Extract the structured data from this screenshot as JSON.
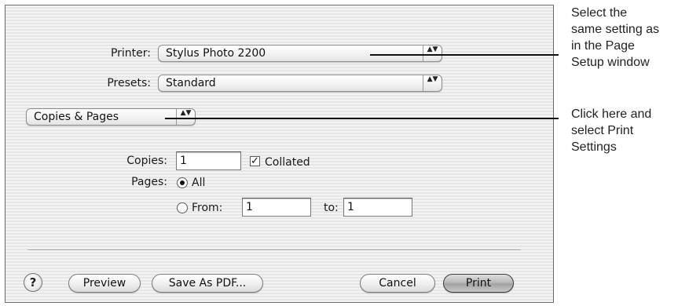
{
  "dialog": {
    "printer": {
      "label": "Printer:",
      "value": "Stylus Photo 2200",
      "arrows": "▲▼"
    },
    "presets": {
      "label": "Presets:",
      "value": "Standard",
      "arrows": "▲▼"
    },
    "panel_menu": {
      "value": "Copies & Pages",
      "arrows": "▲▼"
    },
    "copies": {
      "label": "Copies:",
      "value": "1",
      "collated_label": "Collated",
      "collated_checked": true,
      "checkmark": "✓"
    },
    "pages": {
      "label": "Pages:",
      "all_label": "All",
      "from_label": "From:",
      "from_value": "1",
      "to_label": "to:",
      "to_value": "1",
      "selected": "All"
    },
    "buttons": {
      "help": "?",
      "preview": "Preview",
      "save_pdf": "Save As PDF...",
      "cancel": "Cancel",
      "print": "Print"
    }
  },
  "callouts": {
    "printer_note": [
      "Select the",
      "same setting as",
      "in the Page",
      "Setup window"
    ],
    "menu_note": [
      "Click here and",
      "select Print",
      "Settings"
    ]
  }
}
